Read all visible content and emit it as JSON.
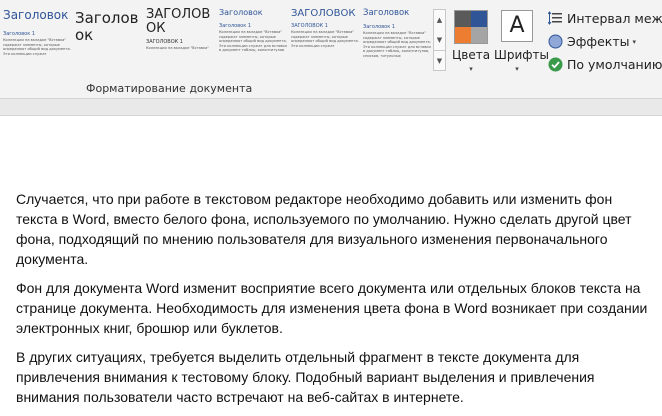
{
  "styles_gallery": {
    "tiles": [
      {
        "heading": "Заголовок",
        "subheading": "Заголовок 1",
        "body": "Коллекции на вкладке \"Вставка\" содержат элементы, которые определяют общий вид документа. Эти коллекции служат"
      },
      {
        "heading": "Заголовок",
        "subheading": "",
        "body": ""
      },
      {
        "heading": "ЗАГОЛОВОК",
        "subheading": "ЗАГОЛОВОК 1",
        "body": "Коллекции на вкладке \"Вставка\""
      },
      {
        "heading": "Заголовок",
        "subheading": "Заголовок 1",
        "body": "Коллекции на вкладке \"Вставка\" содержат элементы, которые определяют общий вид документа. Эти коллекции служат для вставки в документ таблиц, колонтитулов"
      },
      {
        "heading": "ЗАГОЛОВОК",
        "subheading": "ЗАГОЛОВОК 1",
        "body": "Коллекции на вкладке \"Вставка\" содержат элементы, которые определяют общий вид документа. Эти коллекции служат"
      },
      {
        "heading": "Заголовок",
        "subheading": "Заголовок 1",
        "body": "Коллекции на вкладке \"Вставка\" содержат элементы, которые определяют общий вид документа. Эти коллекции служат для вставки в документ таблиц, колонтитулов, списков, титульных"
      }
    ]
  },
  "ribbon": {
    "group_label": "Форматирование документа",
    "colors_label": "Цвета",
    "fonts_label": "Шрифты",
    "fonts_glyph": "A",
    "dropdown_glyph": "▾",
    "spacing_label": "Интервал между",
    "effects_label": "Эффекты",
    "default_label": "По умолчанию"
  },
  "document": {
    "paragraphs": [
      "Случается, что при работе в текстовом редакторе необходимо добавить или изменить фон текста в Word, вместо белого фона, используемого по умолчанию. Нужно сделать другой цвет фона, подходящий по мнению пользователя для визуального изменения первоначального документа.",
      "Фон для документа Word изменит восприятие всего документа или отдельных блоков текста на странице документа. Необходимость для изменения цвета фона в Word возникает при создании электронных книг, брошюр или буклетов.",
      "В других ситуациях, требуется выделить отдельный фрагмент в тексте документа для привлечения внимания к тестовому блоку. Подобный вариант выделения и привлечения внимания пользователи часто встречают на веб-сайтах в интернете."
    ]
  },
  "colors": {
    "heading_blue": "#2f5597",
    "swatch_tl": "#5a5a5a",
    "swatch_tr": "#2f5597",
    "swatch_bl": "#ed7d31",
    "swatch_br": "#a5a5a5",
    "check_green": "#3a9a4a"
  }
}
